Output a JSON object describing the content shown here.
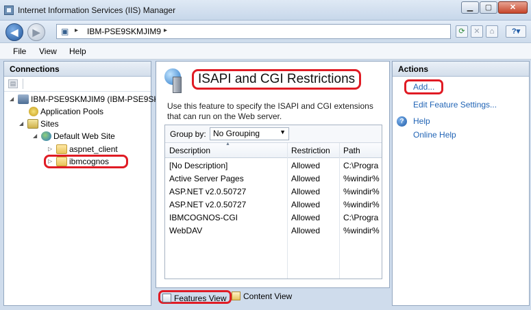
{
  "window": {
    "title": "Internet Information Services (IIS) Manager"
  },
  "window_controls": {
    "minimize": "▁",
    "maximize": "▢",
    "close": "✕"
  },
  "address": {
    "path": "IBM-PSE9SKMJIM9",
    "separator": "▸"
  },
  "toolbar_icons": [
    "refresh-icon",
    "stop-icon",
    "home-icon",
    "help-icon"
  ],
  "menu": {
    "file": "File",
    "view": "View",
    "help": "Help"
  },
  "connections": {
    "header": "Connections",
    "tree": [
      {
        "label": "IBM-PSE9SKMJIM9 (IBM-PSE9SK",
        "expander": "◢",
        "icon": "server-icon"
      },
      {
        "label": "Application Pools",
        "expander": "",
        "icon": "app-pools-icon"
      },
      {
        "label": "Sites",
        "expander": "◢",
        "icon": "sites-icon"
      },
      {
        "label": "Default Web Site",
        "expander": "◢",
        "icon": "website-globe-icon"
      },
      {
        "label": "aspnet_client",
        "expander": "▷",
        "icon": "folder-icon"
      },
      {
        "label": "ibmcognos",
        "expander": "▷",
        "icon": "folder-icon"
      }
    ]
  },
  "feature": {
    "title": "ISAPI and CGI Restrictions",
    "description": "Use this feature to specify the ISAPI and CGI extensions that can run on the Web server.",
    "groupby_label": "Group by:",
    "groupby_value": "No Grouping",
    "columns": [
      "Description",
      "Restriction",
      "Path"
    ],
    "rows": [
      {
        "description": "[No Description]",
        "restriction": "Allowed",
        "path": "C:\\Progra"
      },
      {
        "description": "Active Server Pages",
        "restriction": "Allowed",
        "path": "%windir%"
      },
      {
        "description": "ASP.NET v2.0.50727",
        "restriction": "Allowed",
        "path": "%windir%"
      },
      {
        "description": "ASP.NET v2.0.50727",
        "restriction": "Allowed",
        "path": "%windir%"
      },
      {
        "description": "IBMCOGNOS-CGI",
        "restriction": "Allowed",
        "path": "C:\\Progra"
      },
      {
        "description": "WebDAV",
        "restriction": "Allowed",
        "path": "%windir%"
      }
    ]
  },
  "views": {
    "features": "Features View",
    "content": "Content View"
  },
  "actions": {
    "header": "Actions",
    "add": "Add...",
    "edit_settings": "Edit Feature Settings...",
    "help": "Help",
    "online_help": "Online Help"
  },
  "colors": {
    "highlight": "#e01b24",
    "link": "#1f63b5"
  }
}
